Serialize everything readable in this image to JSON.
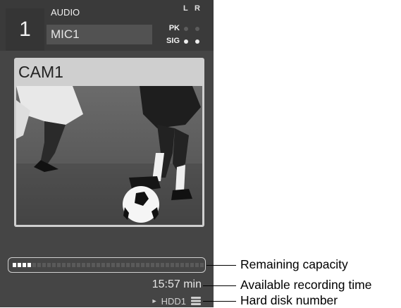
{
  "channel": {
    "number": "1",
    "audio_label": "AUDIO",
    "source": "MIC1",
    "meter": {
      "ch_left": "L",
      "ch_right": "R",
      "pk_label": "PK",
      "sig_label": "SIG",
      "pk_left": false,
      "pk_right": false,
      "sig_left": true,
      "sig_right": true
    }
  },
  "camera": {
    "label": "CAM1",
    "image_desc_icon": "soccer-video-frame"
  },
  "storage": {
    "remaining_capacity_fraction": 0.1,
    "recording_time": "15:57 min",
    "disk_label": "HDD1",
    "disk_icon": "hdd-stack-icon"
  },
  "callouts": {
    "remaining_capacity": "Remaining capacity",
    "available_recording_time": "Available recording time",
    "hard_disk_number": "Hard disk number"
  },
  "colors": {
    "panel_bg": "#454545",
    "header_bg": "#3a3a3a",
    "led_on": "#eeeeee",
    "led_off": "#5c5c5c"
  }
}
